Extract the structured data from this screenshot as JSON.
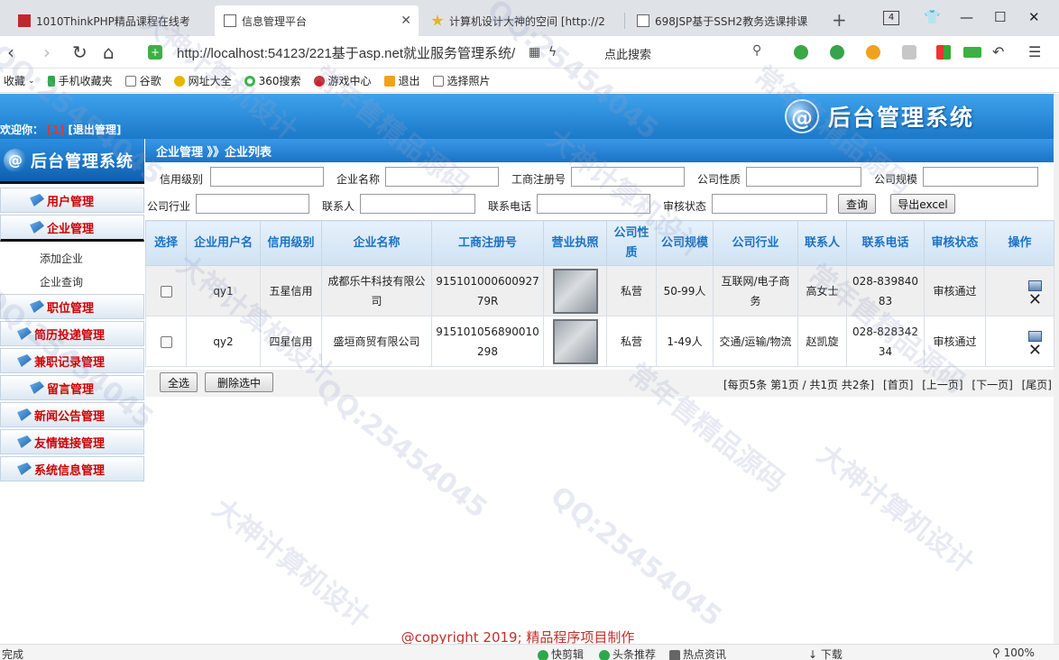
{
  "browser": {
    "tabs": [
      {
        "title": "1010ThinkPHP精品课程在线考",
        "active": false
      },
      {
        "title": "信息管理平台",
        "active": true
      },
      {
        "title": "计算机设计大神的空间 [http://2",
        "active": false
      },
      {
        "title": "698JSP基于SSH2教务选课排课",
        "active": false
      }
    ],
    "tab_count": "4",
    "url": "http://localhost:54123/221基于asp.net就业服务管理系统/",
    "search_hint": "点此搜索",
    "bookmarks": [
      "收藏",
      "手机收藏夹",
      "谷歌",
      "网址大全",
      "360搜索",
      "游戏中心",
      "退出",
      "选择照片"
    ]
  },
  "header": {
    "welcome": "欢迎你：",
    "username": "[1]",
    "logout": "[退出管理]",
    "logo_text": "后台管理系统"
  },
  "sidebar": {
    "title": "后台管理系统",
    "menus": [
      {
        "label": "用户管理"
      },
      {
        "label": "企业管理"
      },
      {
        "label": "职位管理"
      },
      {
        "label": "简历投递管理"
      },
      {
        "label": "兼职记录管理"
      },
      {
        "label": "留言管理"
      },
      {
        "label": "新闻公告管理"
      },
      {
        "label": "友情链接管理"
      },
      {
        "label": "系统信息管理"
      }
    ],
    "submenu": [
      "添加企业",
      "企业查询"
    ]
  },
  "main": {
    "breadcrumb": "企业管理 》》企业列表",
    "filters": {
      "credit_level": "信用级别",
      "company_name": "企业名称",
      "reg_no": "工商注册号",
      "nature": "公司性质",
      "scale": "公司规模",
      "industry": "公司行业",
      "contact": "联系人",
      "phone": "联系电话",
      "audit": "审核状态"
    },
    "query_button": "查询",
    "export_button": "导出excel",
    "table": {
      "headers": [
        "选择",
        "企业用户名",
        "信用级别",
        "企业名称",
        "工商注册号",
        "营业执照",
        "公司性质",
        "公司规模",
        "公司行业",
        "联系人",
        "联系电话",
        "审核状态",
        "操作"
      ],
      "rows": [
        {
          "username": "qy1",
          "credit": "五星信用",
          "name": "成都乐牛科技有限公司",
          "reg_no": "915101000600927 79R",
          "nature": "私营",
          "scale": "50-99人",
          "industry": "互联网/电子商务",
          "contact": "高女士",
          "phone": "028-83984083",
          "audit": "审核通过"
        },
        {
          "username": "qy2",
          "credit": "四星信用",
          "name": "盛垣商贸有限公司",
          "reg_no": "915101056890010298",
          "nature": "私营",
          "scale": "1-49人",
          "industry": "交通/运输/物流",
          "contact": "赵凯旋",
          "phone": "028-82834234",
          "audit": "审核通过"
        }
      ]
    },
    "select_all": "全选",
    "delete_selected": "删除选中",
    "pager": {
      "summary": "[每页5条 第1页 / 共1页 共2条]",
      "first": "[首页]",
      "prev": "[上一页]",
      "next": "[下一页]",
      "last": "[尾页]"
    },
    "copyright": "@copyright 2019; 精品程序项目制作"
  },
  "statusbar": {
    "left": "完成",
    "items": [
      "快剪辑",
      "头条推荐",
      "热点资讯",
      "下载",
      "100%"
    ]
  },
  "watermarks": [
    "QQ:25454045",
    "大神计算机设计",
    "常年售精品源码",
    "QQ:25454045",
    "大神计算机设计",
    "常年售精品源码",
    "QQ:25454045",
    "大神计算机设计",
    "常年售精品源码",
    "QQ:25454045",
    "大神计算机设计",
    "常年售精品源码",
    "QQ:25454045",
    "大神计算机设计"
  ],
  "colors": {
    "accent": "#1b79c8",
    "menu_text": "#cc0000",
    "header_text": "#1b72c4"
  }
}
